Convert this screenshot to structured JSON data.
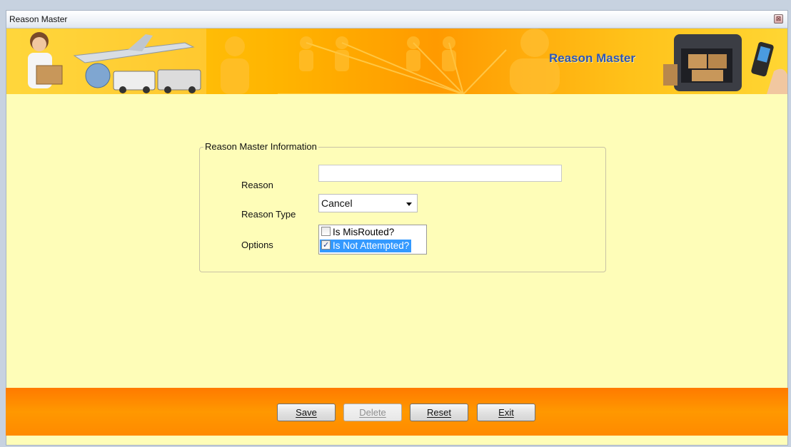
{
  "window": {
    "title": "Reason Master",
    "close_glyph": "⊠"
  },
  "banner": {
    "title": "Reason Master"
  },
  "form": {
    "group_title": "Reason Master Information",
    "reason_label": "Reason",
    "reason_value": "",
    "reason_type_label": "Reason Type",
    "reason_type_value": "Cancel",
    "options_label": "Options",
    "options": [
      {
        "label": "Is MisRouted?",
        "checked": false,
        "selected": false
      },
      {
        "label": "Is Not Attempted?",
        "checked": true,
        "selected": true
      }
    ]
  },
  "buttons": {
    "save": "Save",
    "delete": "Delete",
    "reset": "Reset",
    "exit": "Exit"
  },
  "colors": {
    "form_background": "#fefdb8",
    "banner_title": "#2d55b8",
    "footer": "#ff8a00",
    "selection": "#3399ff"
  },
  "icons": [
    "close-icon",
    "checkbox-icon",
    "dropdown-arrow-icon"
  ]
}
